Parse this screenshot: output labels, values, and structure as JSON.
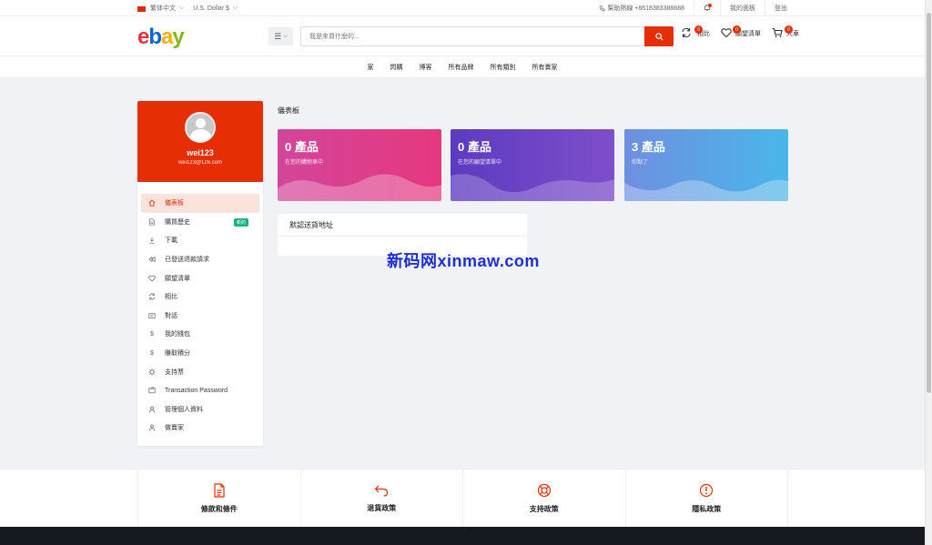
{
  "topbar": {
    "language": "繁体中文",
    "currency": "U.S. Dollar $",
    "helpline": "幫助熱線 +8618383388888",
    "dashboard_link": "我的面板",
    "logout": "登出"
  },
  "header": {
    "logo_letters": [
      "e",
      "b",
      "a",
      "y"
    ],
    "search_placeholder": "我是來買什麼的...",
    "compare": {
      "label": "相比",
      "count": "0"
    },
    "wishlist": {
      "label": "願望清單",
      "count": "0"
    },
    "cart": {
      "label": "大車",
      "count": "0"
    }
  },
  "nav": [
    "家",
    "閃購",
    "博客",
    "所有品牌",
    "所有類別",
    "所有賣家"
  ],
  "profile": {
    "name": "wei123",
    "email": "wei123@126.com"
  },
  "sidebar": {
    "items": [
      {
        "label": "儀表板",
        "icon": "home-icon",
        "active": true
      },
      {
        "label": "購買歷史",
        "icon": "file-icon",
        "badge": "新的"
      },
      {
        "label": "下載",
        "icon": "download-icon"
      },
      {
        "label": "已發送退款請求",
        "icon": "backward-icon"
      },
      {
        "label": "願望清單",
        "icon": "heart-icon"
      },
      {
        "label": "相比",
        "icon": "refresh-icon"
      },
      {
        "label": "對話",
        "icon": "chat-icon"
      },
      {
        "label": "我的錢包",
        "icon": "dollar-icon"
      },
      {
        "label": "賺取積分",
        "icon": "dollar-icon"
      },
      {
        "label": "支持票",
        "icon": "gear-icon"
      },
      {
        "label": "Transaction Password",
        "icon": "wallet-icon"
      },
      {
        "label": "管理個人資料",
        "icon": "user-icon"
      },
      {
        "label": "做賣家",
        "icon": "user-icon"
      }
    ]
  },
  "main": {
    "title": "儀表板",
    "cards": [
      {
        "value": "0 產品",
        "desc": "在您的購物車中"
      },
      {
        "value": "0 產品",
        "desc": "在您的願望清單中"
      },
      {
        "value": "3 產品",
        "desc": "你點了"
      }
    ],
    "address_title": "默認送貨地址"
  },
  "watermark": "新码网xinmaw.com",
  "policies": [
    {
      "label": "條款和條件",
      "icon": "document-icon"
    },
    {
      "label": "退貨政策",
      "icon": "return-icon"
    },
    {
      "label": "支持政策",
      "icon": "lifebuoy-icon"
    },
    {
      "label": "隱私政策",
      "icon": "alert-icon"
    }
  ],
  "colors": {
    "accent": "#e62e04",
    "success": "#16b47c"
  }
}
